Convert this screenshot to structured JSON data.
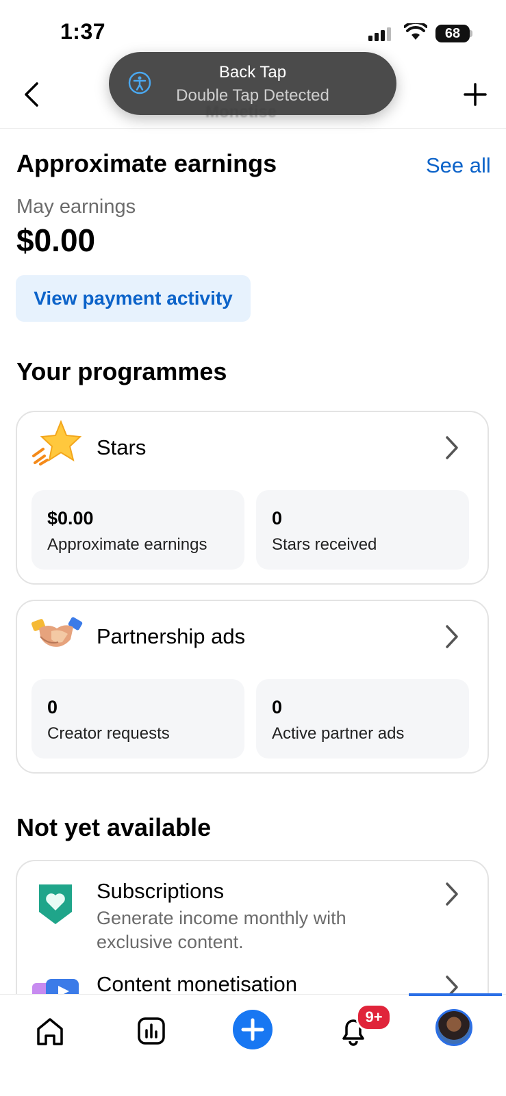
{
  "status_bar": {
    "time": "1:37",
    "battery": "68"
  },
  "header": {
    "title": "Monetise"
  },
  "toast": {
    "title": "Back Tap",
    "subtitle": "Double Tap Detected"
  },
  "earnings": {
    "title": "Approximate earnings",
    "see_all": "See all",
    "month_label": "May earnings",
    "amount": "$0.00",
    "payment_button": "View payment activity"
  },
  "programmes": {
    "title": "Your programmes",
    "cards": [
      {
        "name": "Stars",
        "icon": "star-icon",
        "stats": [
          {
            "value": "$0.00",
            "label": "Approximate earnings"
          },
          {
            "value": "0",
            "label": "Stars received"
          }
        ]
      },
      {
        "name": "Partnership ads",
        "icon": "handshake-icon",
        "stats": [
          {
            "value": "0",
            "label": "Creator requests"
          },
          {
            "value": "0",
            "label": "Active partner ads"
          }
        ]
      }
    ]
  },
  "not_available": {
    "title": "Not yet available",
    "items": [
      {
        "name": "Subscriptions",
        "description": "Generate income monthly with exclusive content.",
        "icon": "heart-shield-icon"
      },
      {
        "name": "Content monetisation",
        "icon": "video-icon"
      }
    ]
  },
  "nav": {
    "notification_badge": "9+",
    "items": [
      "home-icon",
      "insights-icon",
      "create-icon",
      "bell-icon",
      "avatar"
    ]
  },
  "colors": {
    "accent": "#0c63c9",
    "nav_accent": "#2b6fe6",
    "badge": "#e0243a"
  }
}
